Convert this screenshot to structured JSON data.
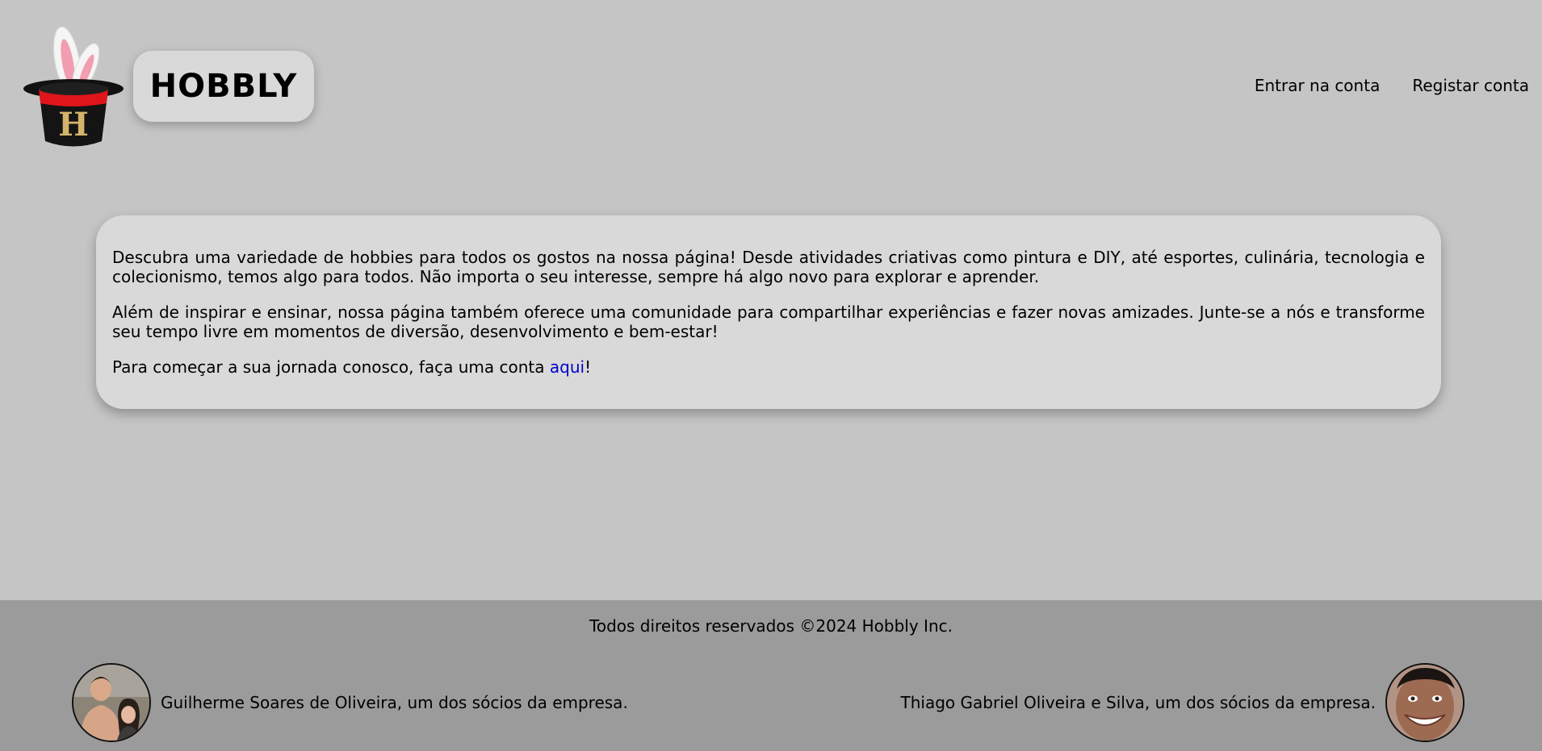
{
  "header": {
    "brand_name": "HOBBLY",
    "nav": {
      "login": "Entrar na conta",
      "register": "Registar conta"
    }
  },
  "main": {
    "paragraph_1": "Descubra uma variedade de hobbies para todos os gostos na nossa página! Desde atividades criativas como pintura e DIY, até esportes, culinária, tecnologia e colecionismo, temos algo para todos. Não importa o seu interesse, sempre há algo novo para explorar e aprender.",
    "paragraph_2": "Além de inspirar e ensinar, nossa página também oferece uma comunidade para compartilhar experiências e fazer novas amizades. Junte-se a nós e transforme seu tempo livre em momentos de diversão, desenvolvimento e bem-estar!",
    "paragraph_3_prefix": "Para começar a sua jornada conosco, faça uma conta ",
    "paragraph_3_link": "aqui",
    "paragraph_3_suffix": "!"
  },
  "footer": {
    "copyright": "Todos direitos reservados ©2024 Hobbly Inc.",
    "partner_left": "Guilherme Soares de Oliveira, um dos sócios da empresa.",
    "partner_right": "Thiago Gabriel Oliveira e Silva, um dos sócios da empresa."
  },
  "colors": {
    "background": "#c5c5c5",
    "card": "#d9d9d9",
    "footer": "#9b9b9b",
    "link": "#0000cc",
    "hat_band": "#e0141b"
  }
}
